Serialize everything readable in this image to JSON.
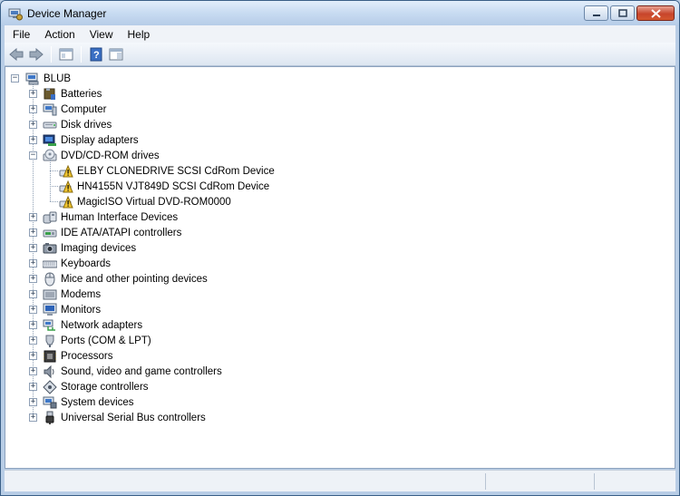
{
  "window": {
    "title": "Device Manager"
  },
  "menu": [
    "File",
    "Action",
    "View",
    "Help"
  ],
  "toolbar": {
    "buttons": [
      "back-arrow-icon",
      "forward-arrow-icon",
      "properties-icon",
      "help-icon",
      "console-tree-icon"
    ]
  },
  "tree": {
    "root": "BLUB",
    "categories": [
      {
        "label": "Batteries",
        "icon": "battery-icon",
        "expanded": false
      },
      {
        "label": "Computer",
        "icon": "computer-icon",
        "expanded": false
      },
      {
        "label": "Disk drives",
        "icon": "disk-drive-icon",
        "expanded": false
      },
      {
        "label": "Display adapters",
        "icon": "display-adapter-icon",
        "expanded": false
      },
      {
        "label": "DVD/CD-ROM drives",
        "icon": "dvd-drive-icon",
        "expanded": true,
        "children": [
          {
            "label": "ELBY CLONEDRIVE SCSI CdRom Device",
            "icon": "dvd-warning-icon"
          },
          {
            "label": "HN4155N VJT849D SCSI CdRom Device",
            "icon": "dvd-warning-icon"
          },
          {
            "label": "MagicISO Virtual DVD-ROM0000",
            "icon": "dvd-warning-icon"
          }
        ]
      },
      {
        "label": "Human Interface Devices",
        "icon": "hid-icon",
        "expanded": false
      },
      {
        "label": "IDE ATA/ATAPI controllers",
        "icon": "ide-controller-icon",
        "expanded": false
      },
      {
        "label": "Imaging devices",
        "icon": "imaging-device-icon",
        "expanded": false
      },
      {
        "label": "Keyboards",
        "icon": "keyboard-icon",
        "expanded": false
      },
      {
        "label": "Mice and other pointing devices",
        "icon": "mouse-icon",
        "expanded": false
      },
      {
        "label": "Modems",
        "icon": "modem-icon",
        "expanded": false
      },
      {
        "label": "Monitors",
        "icon": "monitor-icon",
        "expanded": false
      },
      {
        "label": "Network adapters",
        "icon": "network-adapter-icon",
        "expanded": false
      },
      {
        "label": "Ports (COM & LPT)",
        "icon": "port-icon",
        "expanded": false
      },
      {
        "label": "Processors",
        "icon": "processor-icon",
        "expanded": false
      },
      {
        "label": "Sound, video and game controllers",
        "icon": "sound-icon",
        "expanded": false
      },
      {
        "label": "Storage controllers",
        "icon": "storage-controller-icon",
        "expanded": false
      },
      {
        "label": "System devices",
        "icon": "system-device-icon",
        "expanded": false
      },
      {
        "label": "Universal Serial Bus controllers",
        "icon": "usb-icon",
        "expanded": false
      }
    ]
  }
}
